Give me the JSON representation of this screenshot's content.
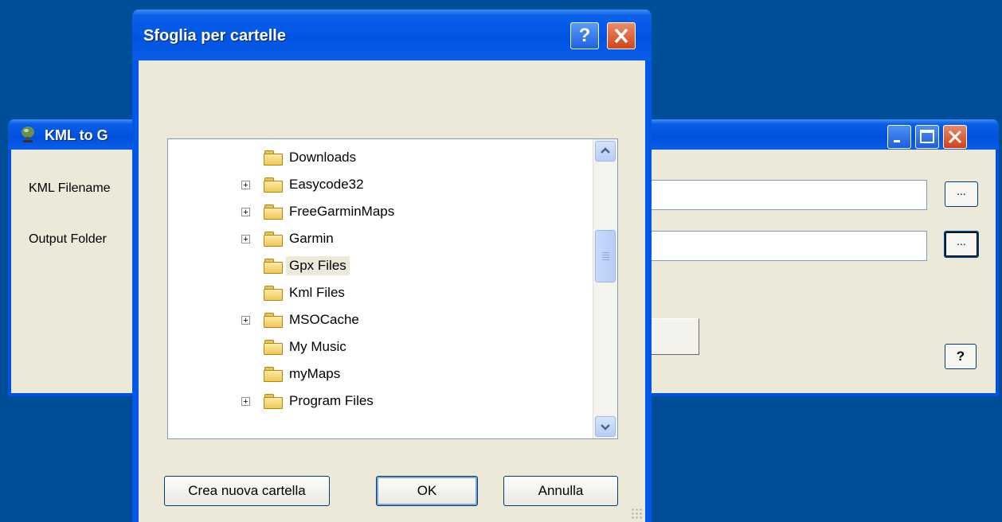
{
  "main_window": {
    "title": "KML to G",
    "labels": {
      "kml_filename": "KML Filename",
      "output_folder": "Output Folder"
    },
    "browse_label": "...",
    "help_label": "?"
  },
  "dialog": {
    "title": "Sfoglia per cartelle",
    "help_label": "?",
    "folders": [
      {
        "name": "Downloads",
        "expandable": false
      },
      {
        "name": "Easycode32",
        "expandable": true
      },
      {
        "name": "FreeGarminMaps",
        "expandable": true
      },
      {
        "name": "Garmin",
        "expandable": true
      },
      {
        "name": "Gpx Files",
        "expandable": false,
        "selected": true
      },
      {
        "name": "Kml Files",
        "expandable": false
      },
      {
        "name": "MSOCache",
        "expandable": true
      },
      {
        "name": "My Music",
        "expandable": false
      },
      {
        "name": "myMaps",
        "expandable": false
      },
      {
        "name": "Program Files",
        "expandable": true
      }
    ],
    "buttons": {
      "new_folder": "Crea nuova cartella",
      "ok": "OK",
      "cancel": "Annulla"
    }
  },
  "colors": {
    "desktop": "#004e98",
    "titlebar": "#0054e3",
    "client": "#ece9d8"
  }
}
